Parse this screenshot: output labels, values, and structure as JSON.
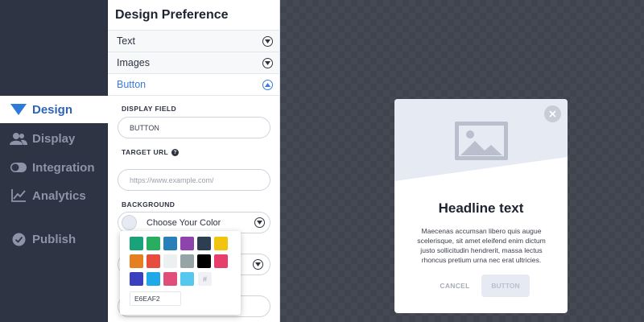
{
  "nav": {
    "items": [
      {
        "label": "Design",
        "icon": "diamond-icon",
        "active": true
      },
      {
        "label": "Display",
        "icon": "users-icon"
      },
      {
        "label": "Integration",
        "icon": "toggle-icon"
      },
      {
        "label": "Analytics",
        "icon": "chart-line-icon"
      },
      {
        "label": "Publish",
        "icon": "check-circle-icon"
      }
    ]
  },
  "panel": {
    "title": "Design Preference",
    "sections": [
      {
        "label": "Text"
      },
      {
        "label": "Images"
      },
      {
        "label": "Button"
      }
    ],
    "display_field": {
      "label": "DISPLAY FIELD",
      "value": "BUTTON"
    },
    "target_url": {
      "label": "TARGET URL",
      "help": "?",
      "placeholder": "https://www.example.com/"
    },
    "background": {
      "label": "BACKGROUND",
      "value": "Choose Your Color",
      "selected_color": "#E6EAF2"
    }
  },
  "color_picker": {
    "swatches": [
      "#1aa37a",
      "#27ae60",
      "#2980b9",
      "#8e44ad",
      "#2c3e50",
      "#f1c40f",
      "#e67e22",
      "#e74c3c",
      "#ecf0f1",
      "#95a5a6",
      "#000000",
      "#e83e6c",
      "#3a3fbf",
      "#1fa9e8",
      "#e04f7a",
      "#56c8f0"
    ],
    "hash_label": "#",
    "hex_value": "E6EAF2"
  },
  "preview": {
    "headline": "Headline text",
    "body": "Maecenas accumsan libero quis augue scelerisque, sit amet eleifend enim dictum justo sollicitudin hendrerit, massa lectus rhoncus pretium urna nec erat ultricies.",
    "cancel_label": "CANCEL",
    "button_label": "BUTTON"
  }
}
